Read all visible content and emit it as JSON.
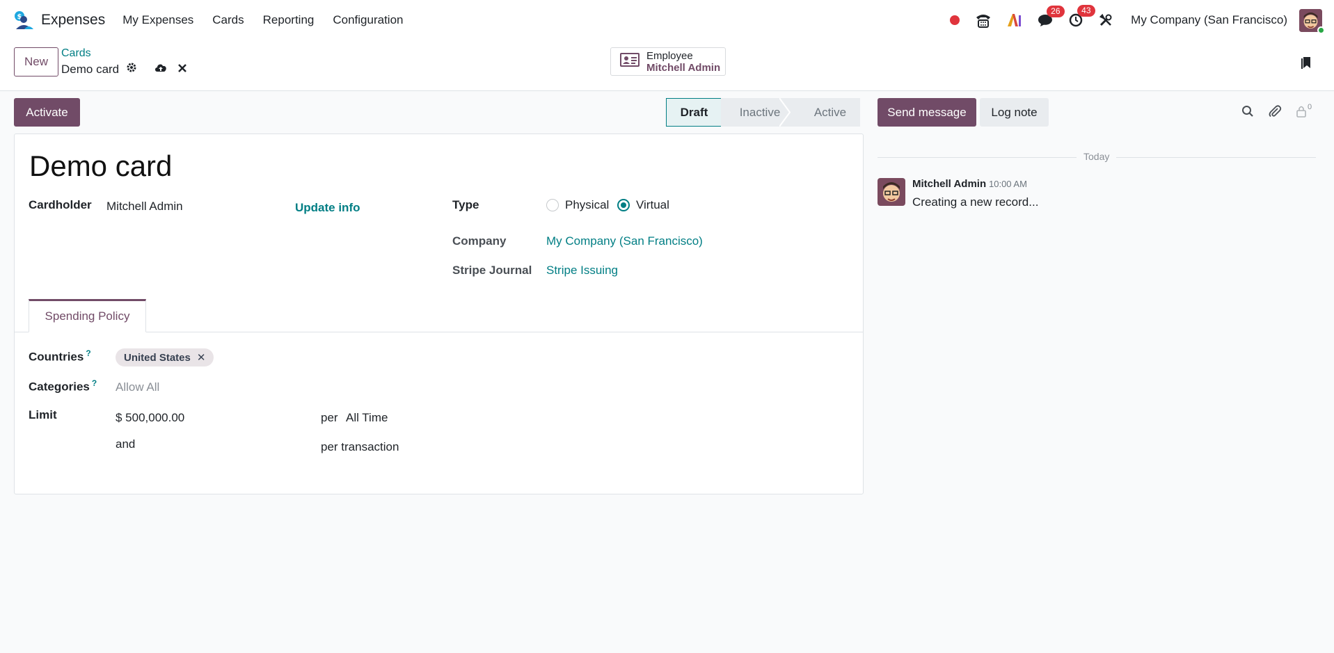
{
  "app": {
    "name": "Expenses"
  },
  "menu": [
    "My Expenses",
    "Cards",
    "Reporting",
    "Configuration"
  ],
  "systray": {
    "messages_count": "26",
    "activities_count": "43",
    "company": "My Company (San Francisco)"
  },
  "breadcrumb": {
    "parent": "Cards",
    "current": "Demo card"
  },
  "control": {
    "new_label": "New"
  },
  "smart_button": {
    "label": "Employee",
    "value": "Mitchell Admin"
  },
  "status": {
    "activate_label": "Activate",
    "stages": [
      "Draft",
      "Inactive",
      "Active"
    ],
    "current_stage": "Draft"
  },
  "form": {
    "title": "Demo card",
    "cardholder_label": "Cardholder",
    "cardholder_value": "Mitchell Admin",
    "update_info": "Update info",
    "type_label": "Type",
    "type_options": [
      "Physical",
      "Virtual"
    ],
    "type_selected": "Virtual",
    "company_label": "Company",
    "company_value": "My Company (San Francisco)",
    "journal_label": "Stripe Journal",
    "journal_value": "Stripe Issuing",
    "tab": "Spending Policy",
    "countries_label": "Countries",
    "countries_help": "?",
    "countries_tags": [
      "United States"
    ],
    "categories_label": "Categories",
    "categories_help": "?",
    "categories_placeholder": "Allow All",
    "limit_label": "Limit",
    "limit_amount": "$ 500,000.00",
    "limit_per": "per",
    "limit_period": "All Time",
    "and_label": "and",
    "per_transaction": "per transaction"
  },
  "chatter": {
    "send_message": "Send message",
    "log_note": "Log note",
    "followers_count": "0",
    "date_separator": "Today",
    "messages": [
      {
        "author": "Mitchell Admin",
        "time": "10:00 AM",
        "body": "Creating a new record..."
      }
    ]
  },
  "colors": {
    "primary": "#714b67",
    "link": "#017e84",
    "badge": "#e0343c",
    "record_dot": "#e0343c"
  }
}
